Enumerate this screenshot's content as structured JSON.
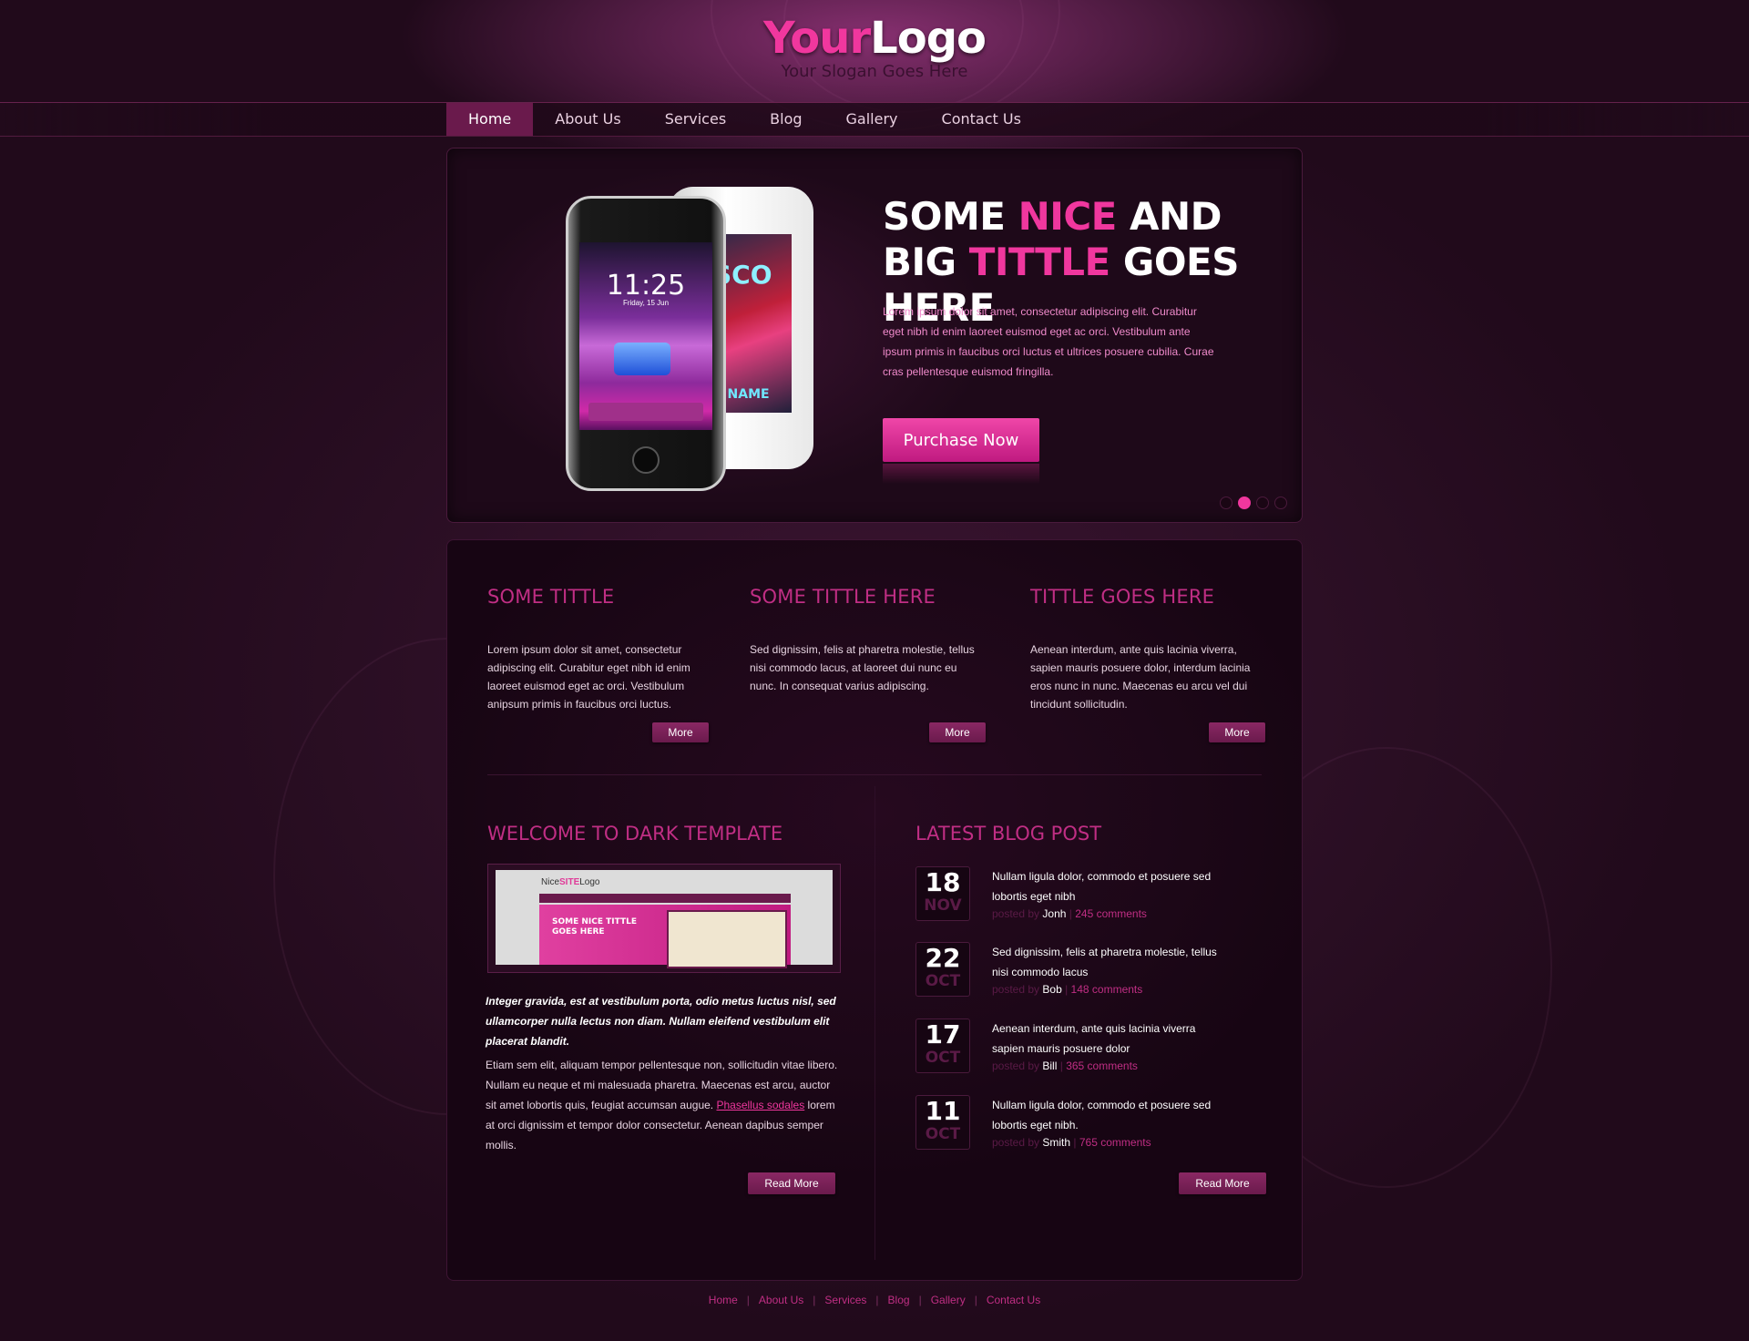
{
  "brand": {
    "logo_part1": "Your",
    "logo_part2": "Logo",
    "slogan": "Your Slogan Goes Here",
    "accent_color": "#f0379e",
    "title_color": "#c02e84"
  },
  "nav": {
    "items": [
      "Home",
      "About Us",
      "Services",
      "Blog",
      "Gallery",
      "Contact Us"
    ],
    "active": "Home"
  },
  "slider": {
    "headline_1": "SOME ",
    "headline_2": "NICE",
    "headline_3": " AND BIG ",
    "headline_4": "TITTLE",
    "headline_5": " GOES HERE",
    "text": "Lorem ipsum dolor sit amet, consectetur adipiscing elit. Curabitur eget nibh id enim laoreet euismod eget ac orci. Vestibulum ante ipsum primis in faucibus orci luctus et ultrices posuere cubilia. Curae cras pellentesque euismod fringilla.",
    "button": "Purchase Now",
    "phone_time": "11:25",
    "phone_date": "Friday, 15 Jun",
    "phone_white_text_1": "SCO",
    "phone_white_text_2": "B NAME",
    "slide_count": 4,
    "active_slide": 2
  },
  "features": [
    {
      "title": "SOME TITTLE",
      "text": "Lorem ipsum dolor sit amet, consectetur adipiscing elit. Curabitur eget nibh id enim laoreet euismod eget ac orci. Vestibulum anipsum primis in faucibus orci luctus.",
      "button": "More"
    },
    {
      "title": "SOME TITTLE HERE",
      "text": "Sed dignissim, felis at pharetra molestie, tellus nisi commodo lacus, at laoreet dui nunc eu nunc. In consequat varius adipiscing.",
      "button": "More"
    },
    {
      "title": "TITTLE GOES HERE",
      "text": "Aenean interdum, ante quis lacinia viverra, sapien mauris posuere dolor, interdum lacinia eros nunc in nunc. Maecenas eu arcu vel dui tincidunt sollicitudin.",
      "button": "More"
    }
  ],
  "welcome": {
    "title": "WELCOME TO DARK TEMPLATE",
    "thumb_site_1": "Nice",
    "thumb_site_2": "SITE",
    "thumb_site_3": "Logo",
    "thumb_hero": "SOME NICE TITTLE GOES HERE",
    "intro": "Integer gravida, est at vestibulum porta, odio metus luctus nisl, sed ullamcorper nulla lectus non diam. Nullam eleifend vestibulum elit placerat blandit.",
    "body_1": "Etiam sem elit, aliquam tempor pellentesque non, sollicitudin vitae libero. Nullam eu neque et mi malesuada pharetra. Maecenas est arcu, auctor sit amet lobortis quis, feugiat accumsan augue. ",
    "body_link": "Phasellus sodales",
    "body_2": " lorem at orci dignissim et tempor dolor consectetur. Aenean dapibus semper mollis.",
    "button": "Read More"
  },
  "blog": {
    "title": "LATEST BLOG POST",
    "posted_by": "posted by",
    "posts": [
      {
        "day": "18",
        "month": "NOV",
        "title": "Nullam ligula dolor, commodo et posuere sed lobortis eget nibh",
        "author": "Jonh",
        "comments": "245 comments"
      },
      {
        "day": "22",
        "month": "OCT",
        "title": "Sed dignissim, felis at pharetra molestie, tellus nisi commodo lacus",
        "author": "Bob",
        "comments": "148 comments"
      },
      {
        "day": "17",
        "month": "OCT",
        "title": "Aenean interdum, ante quis lacinia viverra sapien mauris posuere dolor",
        "author": "Bill",
        "comments": "365 comments"
      },
      {
        "day": "11",
        "month": "OCT",
        "title": "Nullam ligula dolor, commodo et posuere sed lobortis eget nibh.",
        "author": "Smith",
        "comments": "765 comments"
      }
    ],
    "button": "Read More"
  },
  "footer": {
    "links": [
      "Home",
      "About Us",
      "Services",
      "Blog",
      "Gallery",
      "Contact Us"
    ],
    "separator": "|"
  }
}
